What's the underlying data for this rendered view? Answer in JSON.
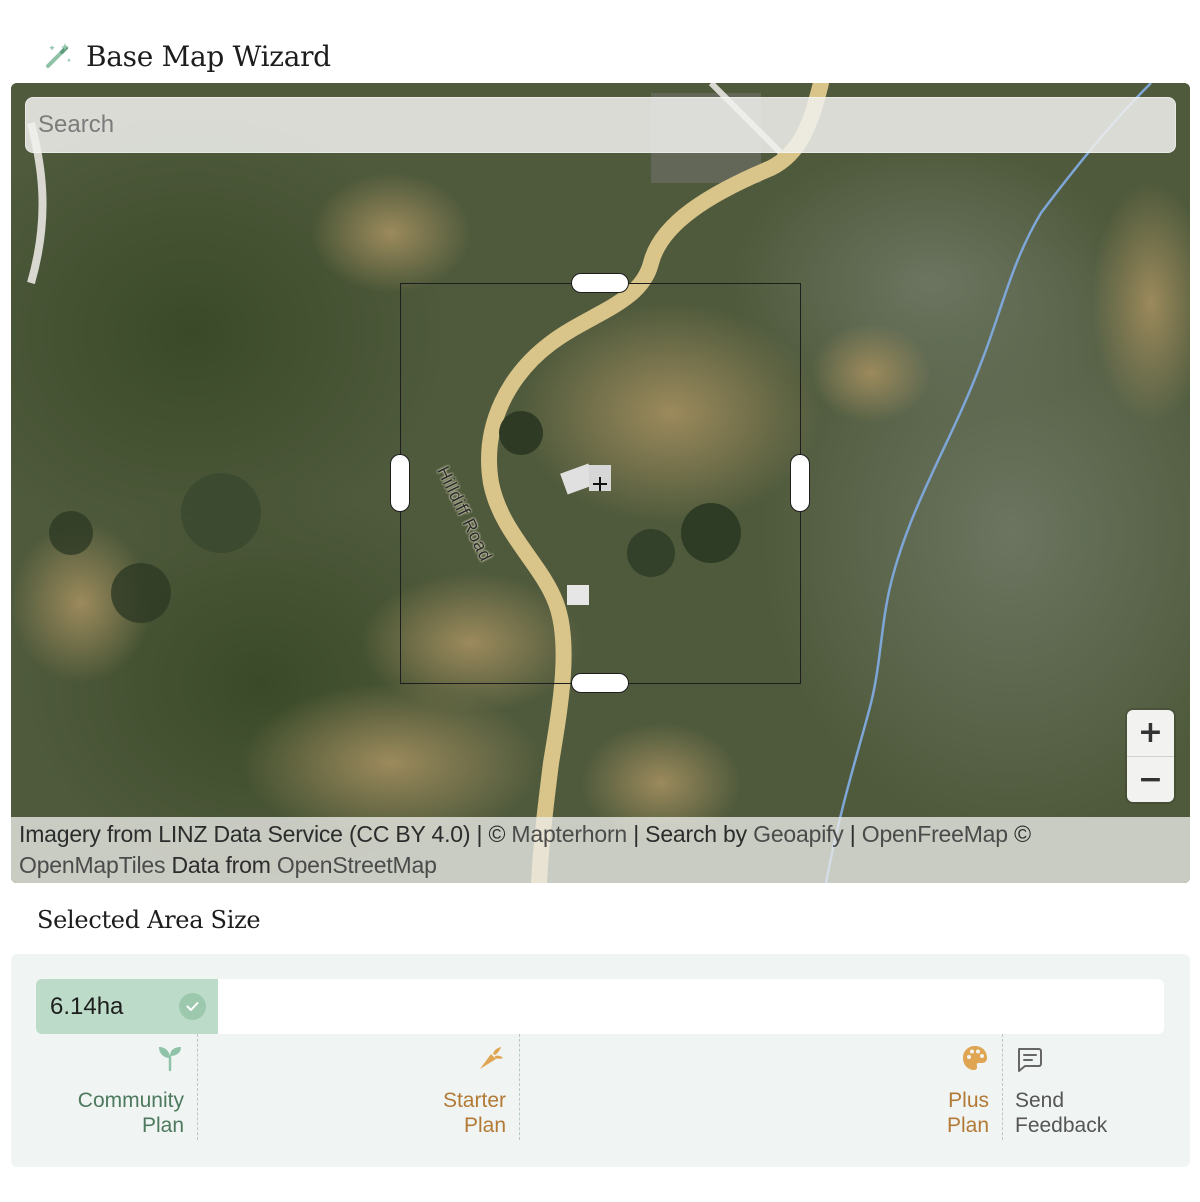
{
  "header": {
    "title": "Base Map Wizard",
    "icon": "magic-wand-icon"
  },
  "map": {
    "search_placeholder": "Search",
    "road_label": "Hilldiff Road",
    "zoom_in_label": "+",
    "zoom_out_label": "−",
    "attribution": {
      "line1_prefix": "Imagery from LINZ Data Service (CC BY 4.0) | © ",
      "mapterhorn": "Mapterhorn",
      "search_by": " | Search by ",
      "geoapify": "Geoapify",
      "sep": " | ",
      "openfreemap": "OpenFreeMap",
      "copy": " © ",
      "openmaptiles": "OpenMapTiles",
      "data_from": " Data from ",
      "openstreetmap": "OpenStreetMap"
    }
  },
  "selected_area": {
    "title": "Selected Area Size",
    "value": "6.14ha",
    "fill_fraction": 0.161
  },
  "plans": [
    {
      "name_line1": "Community",
      "name_line2": "Plan",
      "icon": "sprout-icon",
      "color": "#4d7a5e"
    },
    {
      "name_line1": "Starter",
      "name_line2": "Plan",
      "icon": "carrot-icon",
      "color": "#b37a36"
    },
    {
      "name_line1": "Plus",
      "name_line2": "Plan",
      "icon": "palette-icon",
      "color": "#e0a552"
    }
  ],
  "feedback": {
    "line1": "Send",
    "line2": "Feedback",
    "icon": "message-icon"
  },
  "colors": {
    "fill": "#bcdcc9",
    "panel": "#f0f4f2",
    "accent_green": "#4d7a5e",
    "accent_orange": "#b37a36"
  }
}
